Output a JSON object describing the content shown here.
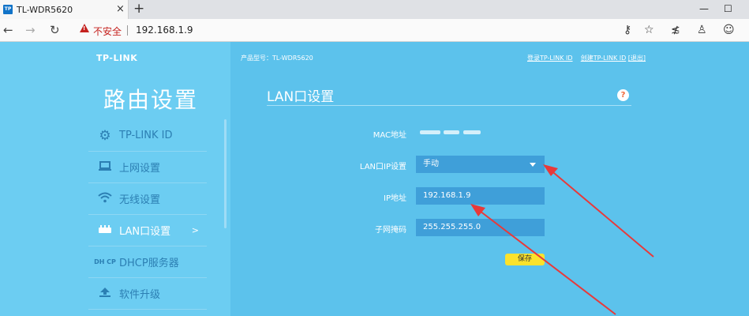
{
  "browser": {
    "tab_favicon": "TP",
    "tab_title": "TL-WDR5620",
    "tab_close": "×",
    "new_tab": "+",
    "win_minimize": "—",
    "win_maximize": "☐",
    "insecure_label": "不安全",
    "url": "192.168.1.9",
    "icons": [
      "back-arrow-icon",
      "forward-arrow-icon",
      "reload-icon",
      "warning-icon",
      "key-icon",
      "star-icon",
      "favorites-icon",
      "profile-icon",
      "emoji-icon"
    ]
  },
  "router": {
    "logo": "TP-LINK",
    "section_title": "路由设置",
    "model": "产品型号：TL-WDR5620",
    "links": {
      "login": "登录TP-LINK ID",
      "create": "创建TP-LINK ID",
      "logout": "[退出]"
    },
    "menu": [
      {
        "label": "TP-LINK ID",
        "icon": "gear-icon"
      },
      {
        "label": "上网设置",
        "icon": "laptop-icon"
      },
      {
        "label": "无线设置",
        "icon": "wifi-icon"
      },
      {
        "label": "LAN口设置",
        "icon": "router-icon",
        "active": true,
        "arrow": ">"
      },
      {
        "label": "DHCP服务器",
        "icon": "dhcp-icon",
        "icon_text": "DH CP"
      },
      {
        "label": "软件升级",
        "icon": "upload-icon"
      }
    ],
    "panel": {
      "title": "LAN口设置",
      "help": "?",
      "mac_label": "MAC地址",
      "lanip_label": "LAN口IP设置",
      "lanip_value": "手动",
      "ip_label": "IP地址",
      "ip_value": "192.168.1.9",
      "mask_label": "子网掩码",
      "mask_value": "255.255.255.0",
      "save": "保存"
    }
  },
  "colors": {
    "app_bg": "#5cc2ec",
    "sidebar_bg": "#6ccdf2",
    "field_bg": "#3f9fd9",
    "save_btn": "#fbe22c",
    "annotation_arrow": "#e8393a"
  }
}
